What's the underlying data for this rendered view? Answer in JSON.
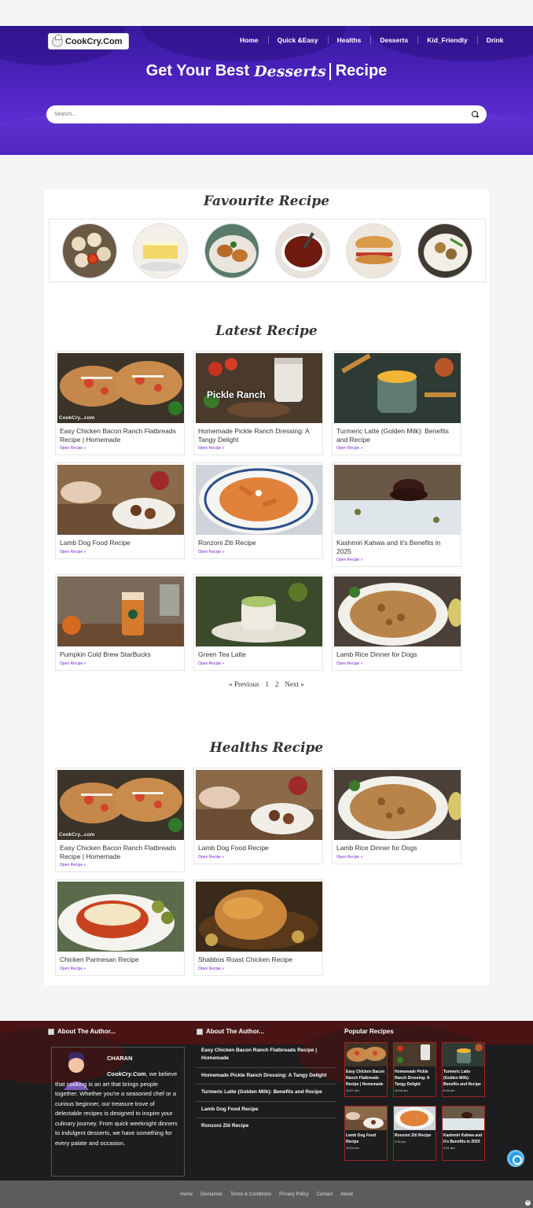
{
  "brand": {
    "name": "CookCry.Com"
  },
  "nav": {
    "items": [
      "Home",
      "Quick &Easy",
      "Healths",
      "Desserts",
      "Kid_Friendly",
      "Drink"
    ]
  },
  "hero": {
    "prefix": "Get Your Best",
    "rotating_word": "Desserts",
    "suffix": "Recipe"
  },
  "search": {
    "placeholder": "Search..."
  },
  "favourite": {
    "title": "Favourite Recipe",
    "items": [
      "dumplings-with-sauce",
      "lemon-cake",
      "cutlets",
      "chili-paste",
      "chicken-sandwich",
      "chicken-vegetable-bowl"
    ]
  },
  "latest": {
    "title": "Latest Recipe",
    "cards": [
      {
        "title": "Easy Chicken Bacon Ranch Flatbreads Recipe | Homemade",
        "link": "Open Recipe »",
        "watermark": "CookCry...com"
      },
      {
        "title": "Homemade Pickle Ranch Dressing: A Tangy Delight",
        "link": "Open Recipe »",
        "overlay": "Pickle Ranch"
      },
      {
        "title": "Turmeric Latte (Golden Milk): Benefits and Recipe",
        "link": "Open Recipe »"
      },
      {
        "title": "Lamb Dog Food Recipe",
        "link": "Open Recipe »"
      },
      {
        "title": "Ronzoni Ziti Recipe",
        "link": "Open Recipe »"
      },
      {
        "title": "Kashmiri Kahwa and it's Benefits in 2025",
        "link": "Open Recipe »"
      },
      {
        "title": "Pumpkin Cold Brew StarBucks",
        "link": "Open Recipe »"
      },
      {
        "title": "Green Tea Latte",
        "link": "Open Recipe »"
      },
      {
        "title": "Lamb Rice Dinner for Dogs",
        "link": "Open Recipe »"
      }
    ]
  },
  "pagination": {
    "previous": "« Previous",
    "pages": [
      "1",
      "2"
    ],
    "next": "Next »"
  },
  "healths": {
    "title": "Healths Recipe",
    "cards": [
      {
        "title": "Easy Chicken Bacon Ranch Flatbreads Recipe | Homemade",
        "link": "Open Recipe »",
        "watermark": "CookCry...com"
      },
      {
        "title": "Lamb Dog Food Recipe",
        "link": "Open Recipe »"
      },
      {
        "title": "Lamb Rice Dinner for Dogs",
        "link": "Open Recipe »"
      },
      {
        "title": "Chicken Parmesan Recipe",
        "link": "Open Recipe »"
      },
      {
        "title": "Shabbos Roast Chicken Recipe",
        "link": "Open Recipe »"
      }
    ]
  },
  "footer": {
    "about_title": "About The Author...",
    "about_title_2": "About The Author...",
    "author_name": "CHARAN",
    "author_brand": "CookCry.Com",
    "author_bio": ", we believe that cooking is an art that brings people together. Whether you're a seasoned chef or a curious beginner, our treasure trove of delectable recipes is designed to inspire your culinary journey. From quick weeknight dinners to indulgent desserts, we have something for every palate and occasion.",
    "links": [
      "Easy Chicken Bacon Ranch Flatbreads Recipe | Homemade",
      "Homemade Pickle Ranch Dressing: A Tangy Delight",
      "Turmeric Latte (Golden Milk): Benefits and Recipe",
      "Lamb Dog Food Recipe",
      "Ronzoni Ziti Recipe"
    ],
    "popular_title": "Popular Recipes",
    "popular": [
      {
        "title": "Easy Chicken Bacon Ranch Flatbreads Recipe | Homemade",
        "time": "10:27 am"
      },
      {
        "title": "Homemade Pickle Ranch Dressing: A Tangy Delight",
        "time": "10:03 am"
      },
      {
        "title": "Turmeric Latte (Golden Milk): Benefits and Recipe",
        "time": "9:08 am"
      },
      {
        "title": "Lamb Dog Food Recipe",
        "time": "10:03 am"
      },
      {
        "title": "Ronzoni Ziti Recipe",
        "time": "3:39 pm"
      },
      {
        "title": "Kashmiri Kahwa and it's Benefits in 2025",
        "time": "3:51 am"
      }
    ]
  },
  "bottom_links": [
    "Home",
    "Disclaimer",
    "Terms & Conditions",
    "Privacy Policy",
    "Contact",
    "About"
  ],
  "colors": {
    "hero": "#4b22bc",
    "link": "#7a22d8",
    "footer": "#1d1d1f",
    "footer_accent": "#a1221f"
  }
}
